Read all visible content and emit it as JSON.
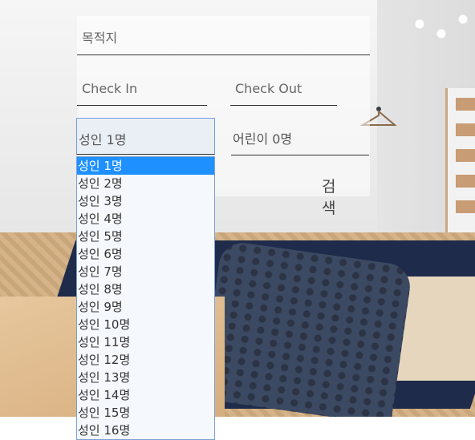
{
  "form": {
    "destination_placeholder": "목적지",
    "checkin_placeholder": "Check In",
    "checkout_placeholder": "Check Out",
    "adults_selected": "성인 1명",
    "children_selected": "어린이 0명",
    "search_label": "검 색"
  },
  "adults_options": [
    "성인 1명",
    "성인 2명",
    "성인 3명",
    "성인 4명",
    "성인 5명",
    "성인 6명",
    "성인 7명",
    "성인 8명",
    "성인 9명",
    "성인 10명",
    "성인 11명",
    "성인 12명",
    "성인 13명",
    "성인 14명",
    "성인 15명",
    "성인 16명"
  ],
  "selected_index": 0,
  "colors": {
    "highlight": "#1e90ff",
    "focus_border": "#6f9ce8"
  }
}
